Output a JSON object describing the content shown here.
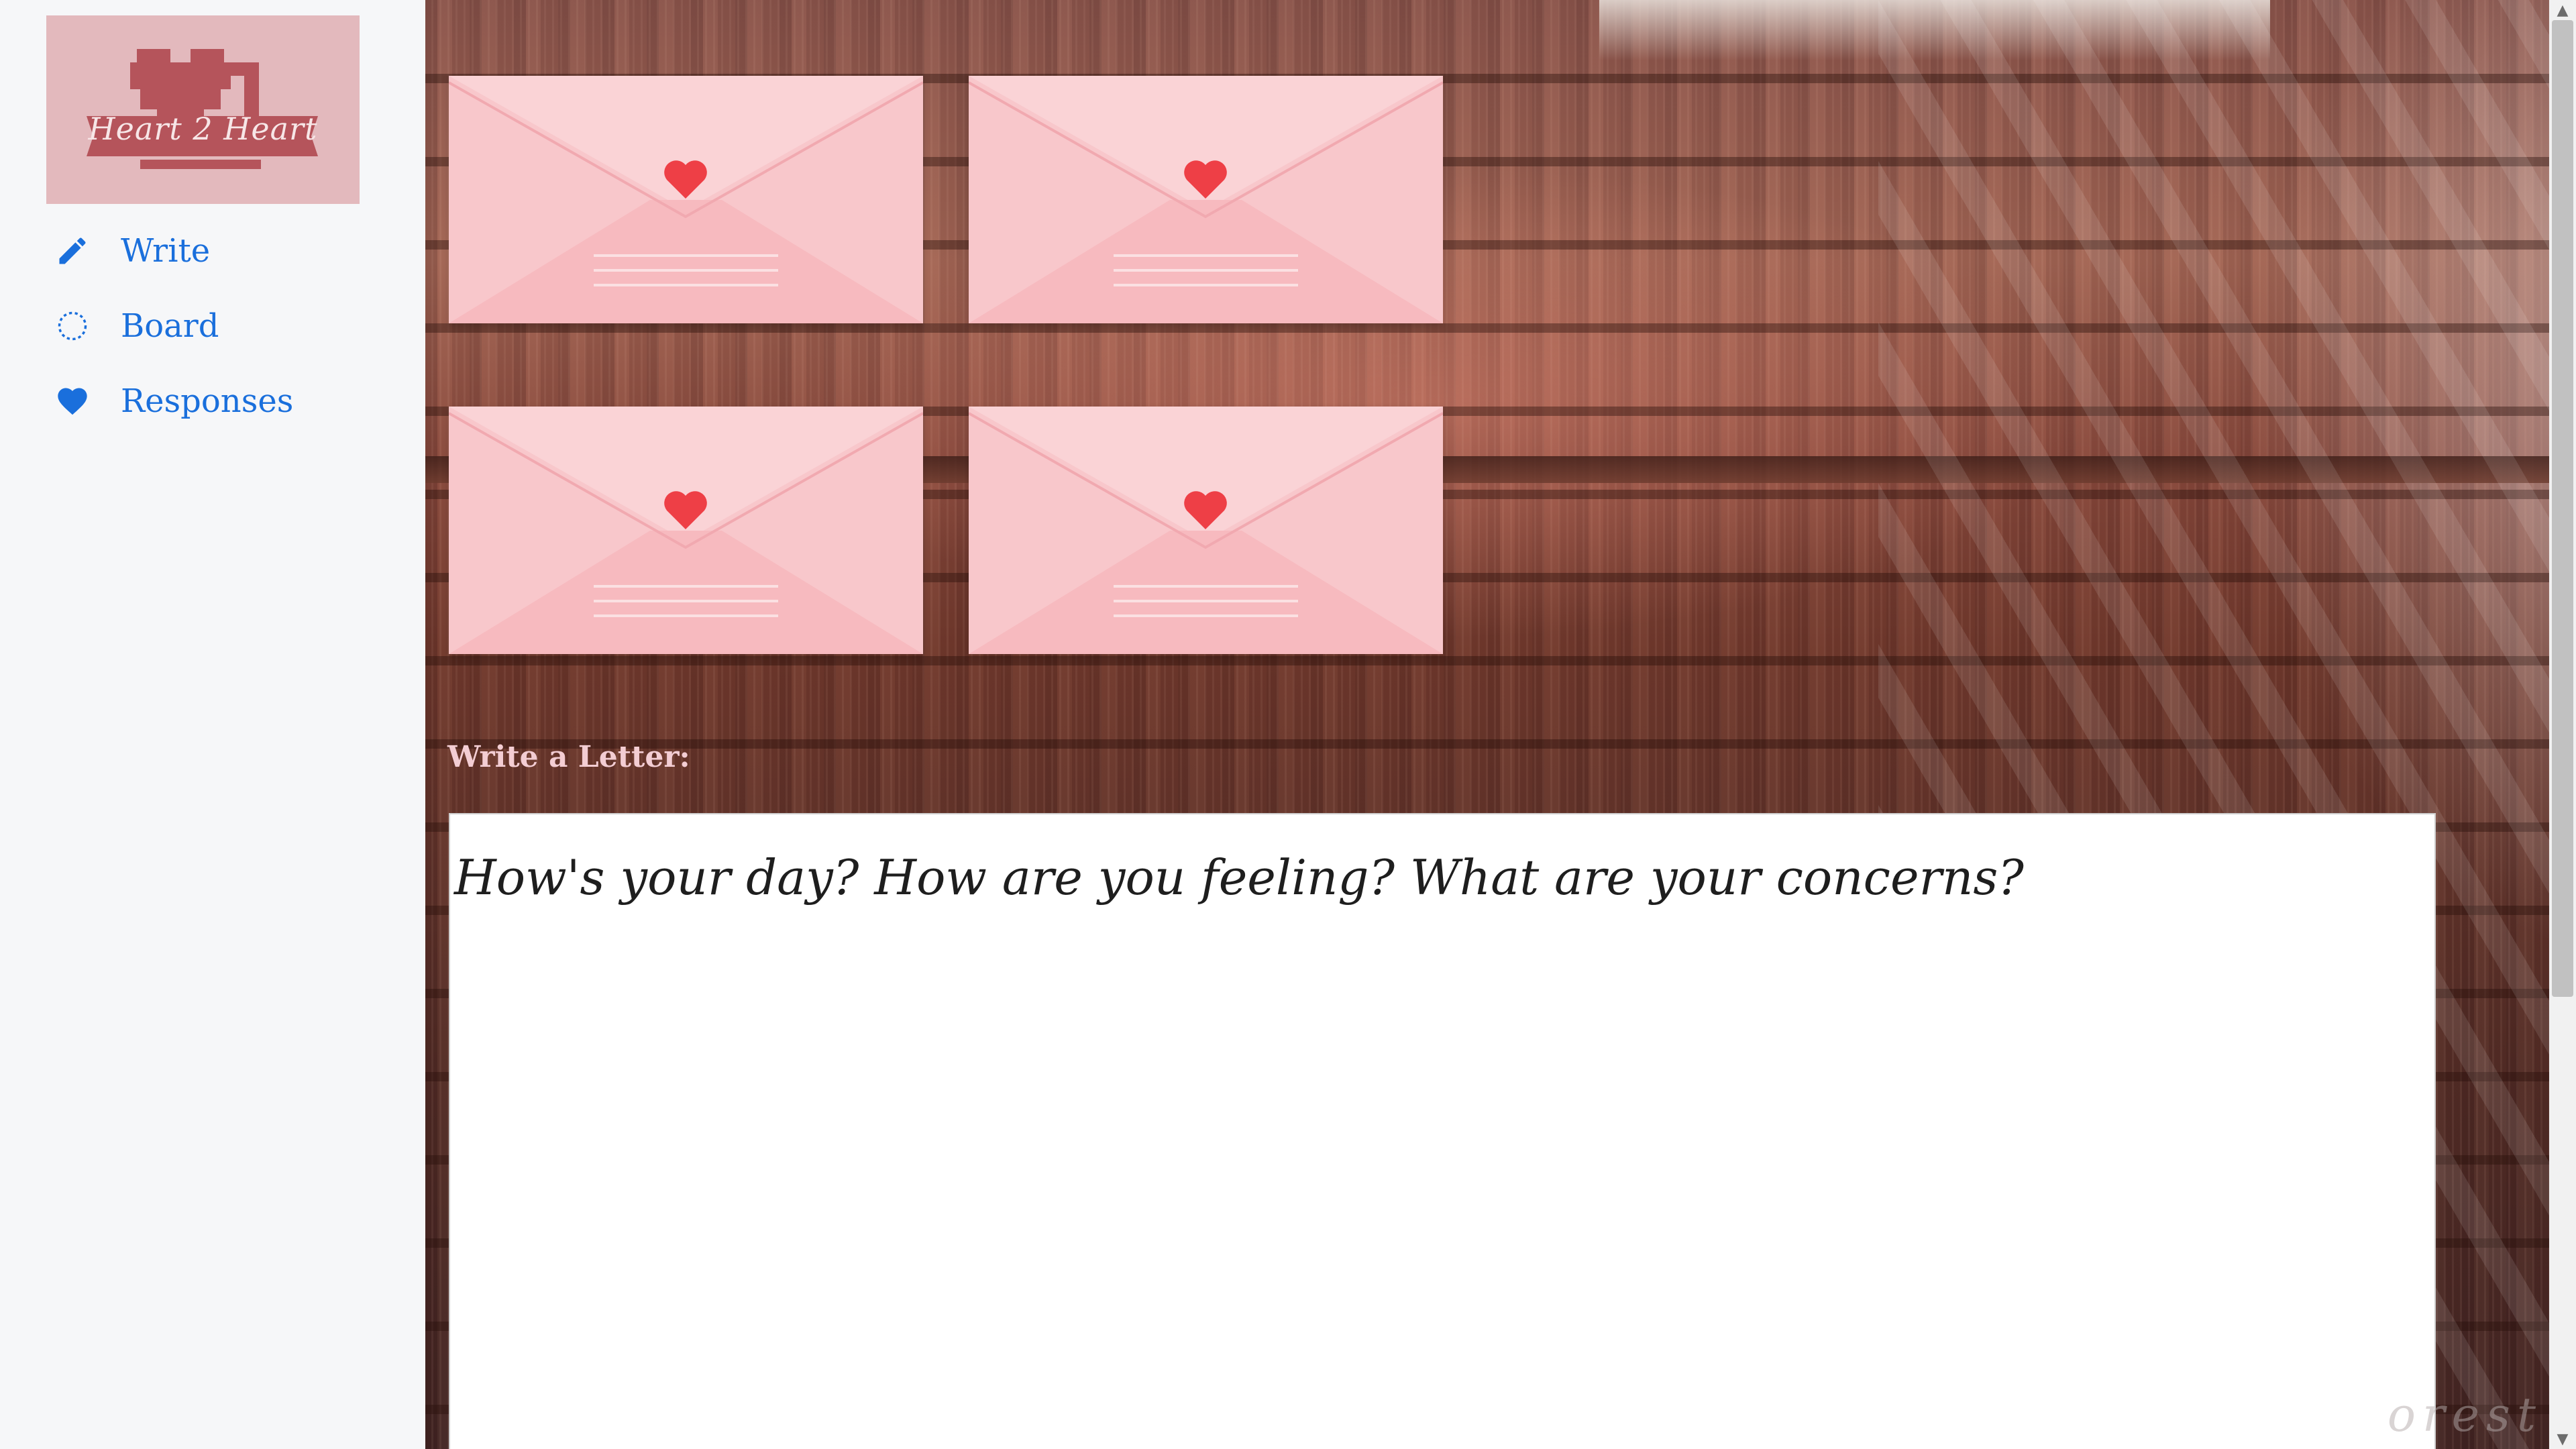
{
  "app": {
    "logo_text": "Heart 2 Heart"
  },
  "nav": {
    "items": [
      {
        "label": "Write",
        "icon": "pencil-icon"
      },
      {
        "label": "Board",
        "icon": "dotted-circle-icon"
      },
      {
        "label": "Responses",
        "icon": "heart-icon"
      }
    ]
  },
  "main": {
    "envelopes": [
      {
        "icon": "envelope-heart-icon"
      },
      {
        "icon": "envelope-heart-icon"
      },
      {
        "icon": "envelope-heart-icon"
      },
      {
        "icon": "envelope-heart-icon"
      }
    ],
    "write_label": "Write a Letter:",
    "letter_placeholder": "How's your day? How are you feeling? What are your concerns?",
    "letter_value": "",
    "watermark": "orest"
  },
  "colors": {
    "nav_link": "#1a6fdc",
    "logo_bg": "#e3b9bd",
    "logo_heart": "#b5545b",
    "envelope": "#f9d0d3",
    "envelope_heart": "#ee3f46"
  }
}
